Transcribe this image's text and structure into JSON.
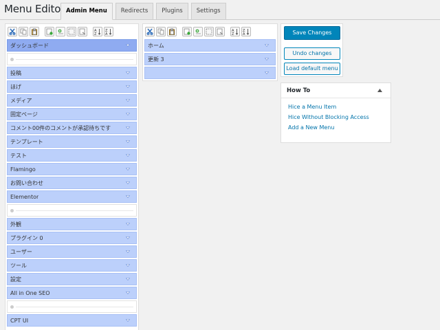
{
  "page": {
    "title": "Menu Editor"
  },
  "tabs": [
    {
      "label": "Admin Menu",
      "active": true
    },
    {
      "label": "Redirects"
    },
    {
      "label": "Plugins"
    },
    {
      "label": "Settings"
    }
  ],
  "toolbar_icons": [
    "cut-icon",
    "copy-icon",
    "paste-icon",
    "new-menu-icon",
    "new-separator-icon",
    "hide-icon",
    "delete-icon",
    "sort-asc-icon",
    "sort-desc-icon"
  ],
  "left_menu": {
    "items": [
      {
        "type": "item",
        "label": "ダッシュボード",
        "selected": true
      },
      {
        "type": "separator"
      },
      {
        "type": "item",
        "label": "投稿"
      },
      {
        "type": "item",
        "label": "ほげ"
      },
      {
        "type": "item",
        "label": "メディア"
      },
      {
        "type": "item",
        "label": "固定ページ"
      },
      {
        "type": "item",
        "label": "コメント00件のコメントが承認待ちです"
      },
      {
        "type": "item",
        "label": "テンプレート"
      },
      {
        "type": "item",
        "label": "テスト"
      },
      {
        "type": "item",
        "label": "Flamingo"
      },
      {
        "type": "item",
        "label": "お問い合わせ"
      },
      {
        "type": "item",
        "label": "Elementor"
      },
      {
        "type": "separator"
      },
      {
        "type": "item",
        "label": "外観"
      },
      {
        "type": "item",
        "label": "プラグイン 0"
      },
      {
        "type": "item",
        "label": "ユーザー"
      },
      {
        "type": "item",
        "label": "ツール"
      },
      {
        "type": "item",
        "label": "設定"
      },
      {
        "type": "item",
        "label": "All in One SEO"
      },
      {
        "type": "separator"
      },
      {
        "type": "item",
        "label": "CPT UI"
      }
    ]
  },
  "right_menu": {
    "items": [
      {
        "label": "ホーム"
      },
      {
        "label": "更新 3"
      },
      {
        "label": ""
      }
    ]
  },
  "actions": {
    "save": "Save Changes",
    "undo": "Undo changes",
    "load_default": "Load default menu"
  },
  "howto": {
    "title": "How To",
    "links": [
      "Hice a Menu Item",
      "Hice Without Blocking Access",
      "Add a New Menu"
    ]
  },
  "colors": {
    "item_bg": "#bcd0fb",
    "item_selected_bg": "#8fabf1",
    "primary_button": "#0085ba",
    "link": "#0073aa"
  }
}
